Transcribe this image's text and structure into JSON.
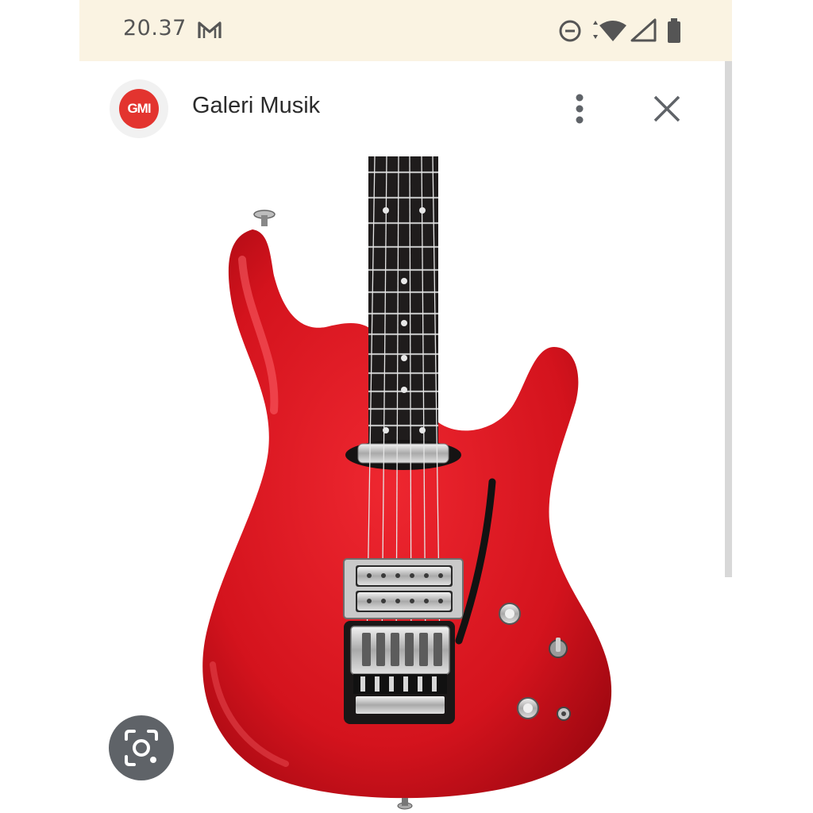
{
  "status_bar": {
    "time": "20.37",
    "icons": [
      "gmail-icon",
      "do-not-disturb-icon",
      "wifi-icon",
      "signal-icon",
      "battery-icon"
    ]
  },
  "header": {
    "logo_text": "GMI",
    "title": "Galeri Musik",
    "menu_icon": "more-vertical-icon",
    "close_icon": "close-icon"
  },
  "image": {
    "subject": "red-electric-guitar",
    "body_color": "#d9141f"
  },
  "fab": {
    "icon": "lens-search-icon"
  },
  "colors": {
    "status_bar_bg": "#faf3e2",
    "lens_button_bg": "#5f6368",
    "logo_red": "#e3342f"
  }
}
